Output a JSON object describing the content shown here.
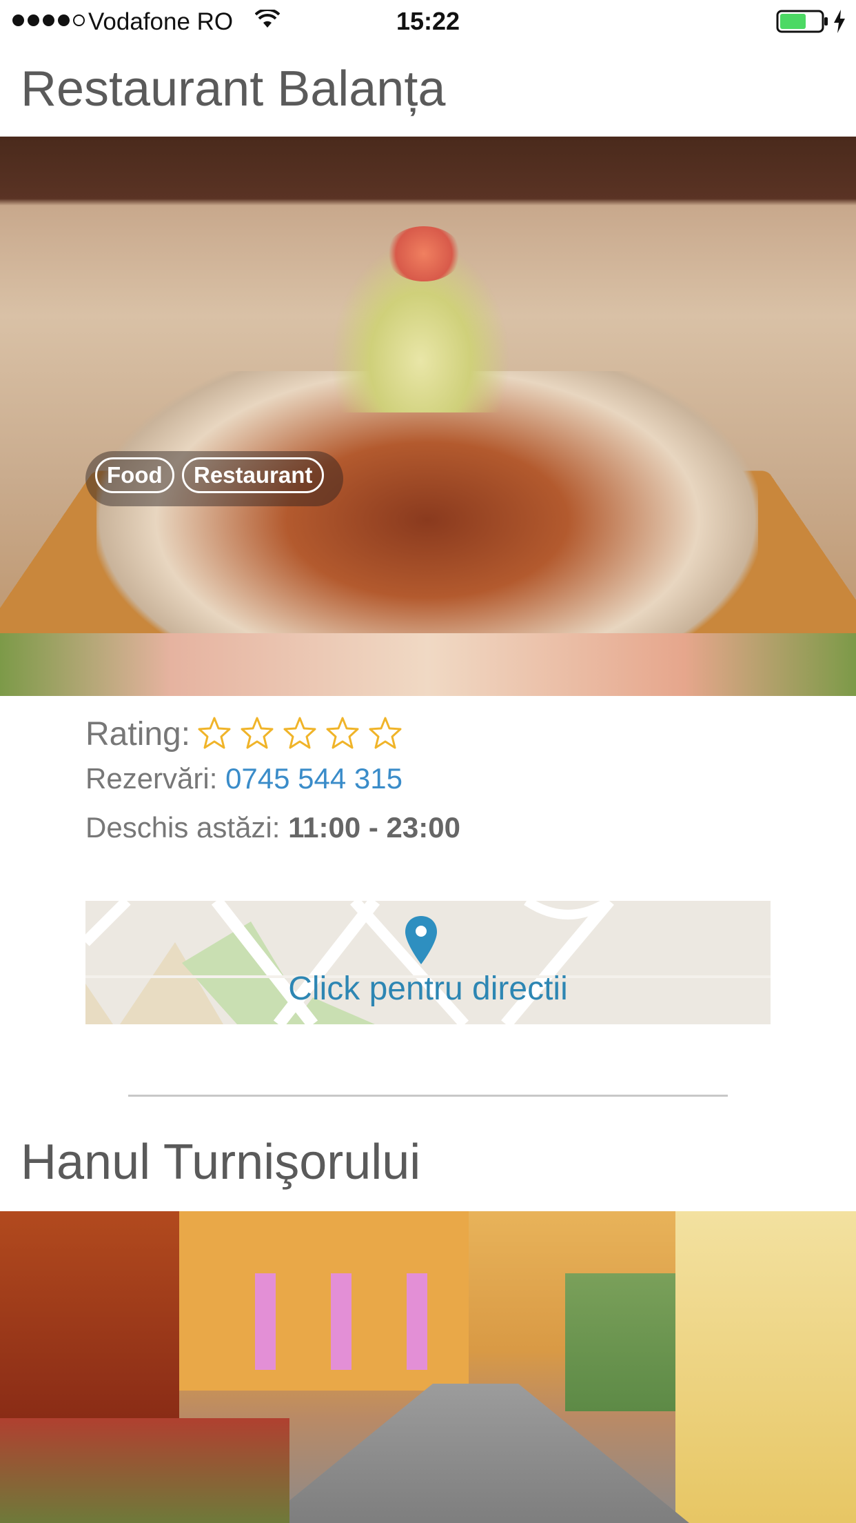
{
  "status_bar": {
    "carrier": "Vodafone RO",
    "time": "15:22",
    "signal_bars_filled": 4,
    "signal_bars_total": 5,
    "battery_level": 0.6,
    "battery_color": "#4cd964"
  },
  "restaurants": [
    {
      "name": "Restaurant Balanța",
      "tags": [
        "Food",
        "Restaurant"
      ],
      "rating_label": "Rating:",
      "stars_filled": 0,
      "stars_total": 5,
      "reservations_label": "Rezervări:",
      "phone": "0745 544 315",
      "open_label": "Deschis astăzi:",
      "hours": "11:00 - 23:00",
      "map_cta": "Click pentru directii"
    },
    {
      "name": "Hanul Turnişorului"
    }
  ],
  "colors": {
    "star": "#f0b429",
    "link": "#3a8cc9",
    "map_link": "#2d86b3",
    "map_pin": "#2e8fc0"
  }
}
